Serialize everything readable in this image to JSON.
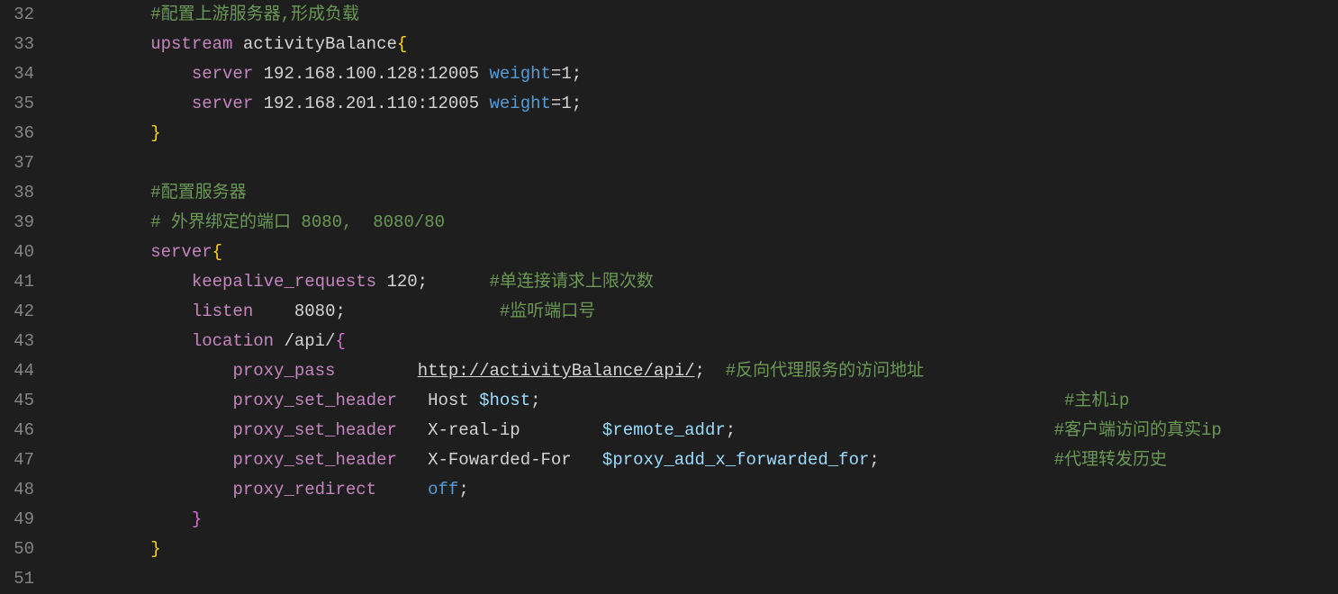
{
  "editor": {
    "first_line_number": 32,
    "lines": [
      {
        "n": 32,
        "indent": 2,
        "tokens": [
          {
            "cls": "tok-comment",
            "t": "#配置上游服务器,形成负载"
          }
        ]
      },
      {
        "n": 33,
        "indent": 2,
        "tokens": [
          {
            "cls": "tok-directive",
            "t": "upstream"
          },
          {
            "cls": "tok-plain",
            "t": " activityBalance"
          },
          {
            "cls": "tok-brace-y",
            "t": "{"
          }
        ]
      },
      {
        "n": 34,
        "indent": 3,
        "tokens": [
          {
            "cls": "tok-directive",
            "t": "server"
          },
          {
            "cls": "tok-plain",
            "t": " 192.168.100.128:12005 "
          },
          {
            "cls": "tok-param",
            "t": "weight"
          },
          {
            "cls": "tok-plain",
            "t": "=1"
          },
          {
            "cls": "tok-semicolon",
            "t": ";"
          }
        ]
      },
      {
        "n": 35,
        "indent": 3,
        "tokens": [
          {
            "cls": "tok-directive",
            "t": "server"
          },
          {
            "cls": "tok-plain",
            "t": " 192.168.201.110:12005 "
          },
          {
            "cls": "tok-param",
            "t": "weight"
          },
          {
            "cls": "tok-plain",
            "t": "=1"
          },
          {
            "cls": "tok-semicolon",
            "t": ";"
          }
        ]
      },
      {
        "n": 36,
        "indent": 2,
        "tokens": [
          {
            "cls": "tok-brace-y",
            "t": "}"
          }
        ]
      },
      {
        "n": 37,
        "indent": 0,
        "tokens": []
      },
      {
        "n": 38,
        "indent": 2,
        "tokens": [
          {
            "cls": "tok-comment",
            "t": "#配置服务器"
          }
        ]
      },
      {
        "n": 39,
        "indent": 2,
        "tokens": [
          {
            "cls": "tok-comment",
            "t": "# 外界绑定的端口 8080,  8080/80"
          }
        ]
      },
      {
        "n": 40,
        "indent": 2,
        "tokens": [
          {
            "cls": "tok-directive",
            "t": "server"
          },
          {
            "cls": "tok-brace-y",
            "t": "{"
          }
        ]
      },
      {
        "n": 41,
        "indent": 3,
        "tokens": [
          {
            "cls": "tok-directive",
            "t": "keepalive_requests"
          },
          {
            "cls": "tok-plain",
            "t": " 120"
          },
          {
            "cls": "tok-semicolon",
            "t": ";"
          },
          {
            "cls": "tok-plain",
            "t": "      "
          },
          {
            "cls": "tok-comment",
            "t": "#单连接请求上限次数"
          }
        ]
      },
      {
        "n": 42,
        "indent": 3,
        "tokens": [
          {
            "cls": "tok-directive",
            "t": "listen"
          },
          {
            "cls": "tok-plain",
            "t": "    8080"
          },
          {
            "cls": "tok-semicolon",
            "t": ";"
          },
          {
            "cls": "tok-plain",
            "t": "               "
          },
          {
            "cls": "tok-comment",
            "t": "#监听端口号"
          }
        ]
      },
      {
        "n": 43,
        "indent": 3,
        "tokens": [
          {
            "cls": "tok-directive",
            "t": "location"
          },
          {
            "cls": "tok-plain",
            "t": " /api/"
          },
          {
            "cls": "tok-brace-p",
            "t": "{"
          }
        ]
      },
      {
        "n": 44,
        "indent": 4,
        "tokens": [
          {
            "cls": "tok-directive",
            "t": "proxy_pass"
          },
          {
            "cls": "tok-plain",
            "t": "        "
          },
          {
            "cls": "tok-url",
            "t": "http://activityBalance/api/"
          },
          {
            "cls": "tok-semicolon",
            "t": ";"
          },
          {
            "cls": "tok-plain",
            "t": "  "
          },
          {
            "cls": "tok-comment",
            "t": "#反向代理服务的访问地址"
          }
        ]
      },
      {
        "n": 45,
        "indent": 4,
        "tokens": [
          {
            "cls": "tok-directive",
            "t": "proxy_set_header"
          },
          {
            "cls": "tok-plain",
            "t": "   Host "
          },
          {
            "cls": "tok-var",
            "t": "$host"
          },
          {
            "cls": "tok-semicolon",
            "t": ";"
          },
          {
            "cls": "tok-plain",
            "t": "                                                   "
          },
          {
            "cls": "tok-comment",
            "t": "#主机ip"
          }
        ]
      },
      {
        "n": 46,
        "indent": 4,
        "tokens": [
          {
            "cls": "tok-directive",
            "t": "proxy_set_header"
          },
          {
            "cls": "tok-plain",
            "t": "   X-real-ip        "
          },
          {
            "cls": "tok-var",
            "t": "$remote_addr"
          },
          {
            "cls": "tok-semicolon",
            "t": ";"
          },
          {
            "cls": "tok-plain",
            "t": "                               "
          },
          {
            "cls": "tok-comment",
            "t": "#客户端访问的真实ip"
          }
        ]
      },
      {
        "n": 47,
        "indent": 4,
        "tokens": [
          {
            "cls": "tok-directive",
            "t": "proxy_set_header"
          },
          {
            "cls": "tok-plain",
            "t": "   X-Fowarded-For   "
          },
          {
            "cls": "tok-var",
            "t": "$proxy_add_x_forwarded_for"
          },
          {
            "cls": "tok-semicolon",
            "t": ";"
          },
          {
            "cls": "tok-plain",
            "t": "                 "
          },
          {
            "cls": "tok-comment",
            "t": "#代理转发历史"
          }
        ]
      },
      {
        "n": 48,
        "indent": 4,
        "tokens": [
          {
            "cls": "tok-directive",
            "t": "proxy_redirect"
          },
          {
            "cls": "tok-plain",
            "t": "     "
          },
          {
            "cls": "tok-param",
            "t": "off"
          },
          {
            "cls": "tok-semicolon",
            "t": ";"
          }
        ]
      },
      {
        "n": 49,
        "indent": 3,
        "tokens": [
          {
            "cls": "tok-brace-p",
            "t": "}"
          }
        ]
      },
      {
        "n": 50,
        "indent": 2,
        "tokens": [
          {
            "cls": "tok-brace-y",
            "t": "}"
          }
        ]
      },
      {
        "n": 51,
        "indent": 0,
        "tokens": []
      }
    ]
  }
}
